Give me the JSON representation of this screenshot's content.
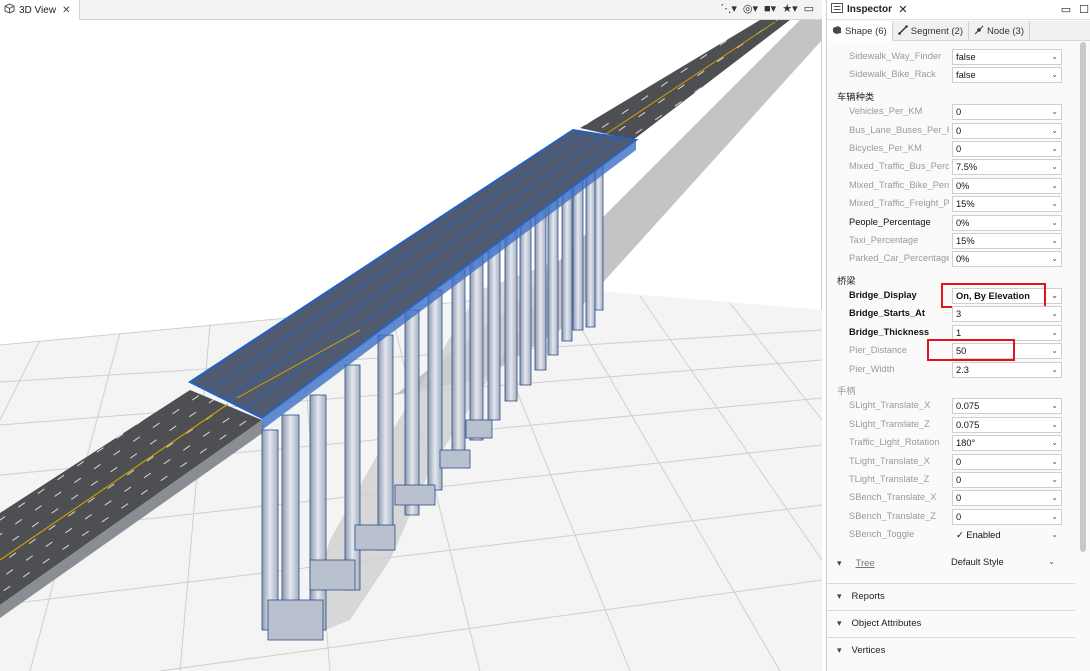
{
  "view": {
    "tab_title": "3D View",
    "close_glyph": "✕",
    "toolbar": [
      "network-icon",
      "layers-icon",
      "camera-icon",
      "bookmark-star-icon"
    ],
    "toolbar_glyphs": {
      "network": "⋱▾",
      "layers": "◎▾",
      "camera": "■▾",
      "star": "★▾",
      "minimize": "▭",
      "maximize": "☐"
    }
  },
  "inspector": {
    "title": "Inspector",
    "close_glyph": "✕",
    "win_glyphs": {
      "minimize": "▭",
      "maximize": "☐"
    },
    "tabs": [
      {
        "label": "Shape (6)",
        "icon": "shape-icon"
      },
      {
        "label": "Segment (2)",
        "icon": "segment-icon"
      },
      {
        "label": "Node (3)",
        "icon": "node-icon"
      }
    ],
    "rows": [
      {
        "type": "prop",
        "name": "Sidewalk_Way_Finder",
        "value": "false",
        "style": "gray"
      },
      {
        "type": "prop",
        "name": "Sidewalk_Bike_Rack",
        "value": "false",
        "style": "gray"
      },
      {
        "type": "header",
        "label": "车辆种类"
      },
      {
        "type": "prop",
        "name": "Vehicles_Per_KM",
        "value": "0",
        "style": "gray"
      },
      {
        "type": "prop",
        "name": "Bus_Lane_Buses_Per_KM",
        "value": "0",
        "style": "gray"
      },
      {
        "type": "prop",
        "name": "Bicycles_Per_KM",
        "value": "0",
        "style": "gray"
      },
      {
        "type": "prop",
        "name": "Mixed_Traffic_Bus_Percentage",
        "value": "7.5%",
        "style": "gray"
      },
      {
        "type": "prop",
        "name": "Mixed_Traffic_Bike_Percentage",
        "value": "0%",
        "style": "gray"
      },
      {
        "type": "prop",
        "name": "Mixed_Traffic_Freight_Percentage",
        "value": "15%",
        "style": "gray"
      },
      {
        "type": "prop",
        "name": "People_Percentage",
        "value": "0%",
        "style": "dark"
      },
      {
        "type": "prop",
        "name": "Taxi_Percentage",
        "value": "15%",
        "style": "gray"
      },
      {
        "type": "prop",
        "name": "Parked_Car_Percentage",
        "value": "0%",
        "style": "gray"
      },
      {
        "type": "header",
        "label": "桥梁"
      },
      {
        "type": "prop",
        "name": "Bridge_Display",
        "value": "On, By Elevation",
        "style": "bold",
        "highlight": true,
        "value_bold": true
      },
      {
        "type": "prop",
        "name": "Bridge_Starts_At",
        "value": "3",
        "style": "bold"
      },
      {
        "type": "prop",
        "name": "Bridge_Thickness",
        "value": "1",
        "style": "bold"
      },
      {
        "type": "prop",
        "name": "Pier_Distance",
        "value": "50",
        "style": "gray",
        "highlight": true
      },
      {
        "type": "prop",
        "name": "Pier_Width",
        "value": "2.3",
        "style": "gray"
      },
      {
        "type": "header",
        "label": "手柄",
        "style": "gray"
      },
      {
        "type": "prop",
        "name": "SLight_Translate_X",
        "value": "0.075",
        "style": "gray"
      },
      {
        "type": "prop",
        "name": "SLight_Translate_Z",
        "value": "0.075",
        "style": "gray"
      },
      {
        "type": "prop",
        "name": "Traffic_Light_Rotation",
        "value": "180°",
        "style": "gray"
      },
      {
        "type": "prop",
        "name": "TLight_Translate_X",
        "value": "0",
        "style": "gray"
      },
      {
        "type": "prop",
        "name": "TLight_Translate_Z",
        "value": "0",
        "style": "gray"
      },
      {
        "type": "prop",
        "name": "SBench_Translate_X",
        "value": "0",
        "style": "gray"
      },
      {
        "type": "prop",
        "name": "SBench_Translate_Z",
        "value": "0",
        "style": "gray"
      },
      {
        "type": "prop",
        "name": "SBench_Toggle",
        "value": "✓ Enabled",
        "style": "gray",
        "no_border": true
      }
    ],
    "tree": {
      "label": "Tree",
      "value": "Default Style"
    },
    "sections": [
      "Reports",
      "Object Attributes",
      "Vertices"
    ],
    "dropdown_glyph": "⌄",
    "chevron_glyph": "❯"
  }
}
